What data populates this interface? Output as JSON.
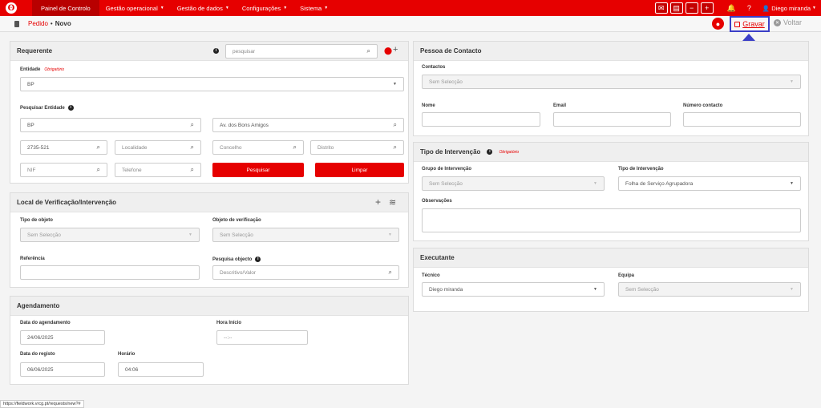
{
  "nav": {
    "items": [
      {
        "label": "Painel de Controlo",
        "caret": ""
      },
      {
        "label": "Gestão operacional",
        "caret": "▼"
      },
      {
        "label": "Gestão de dados",
        "caret": "▼"
      },
      {
        "label": "Configurações",
        "caret": "▼"
      },
      {
        "label": "Sistema",
        "caret": "▼"
      }
    ],
    "user": "Diego miranda"
  },
  "breadcrumb": {
    "link": "Pedido",
    "sep": "•",
    "current": "Novo"
  },
  "actions": {
    "save": "Gravar",
    "back": "Voltar"
  },
  "requerente": {
    "title": "Requerente",
    "search_placeholder": "pesquisar",
    "entidade_label": "Entidade",
    "required": "Obrigatório",
    "entidade_value": "BP",
    "pesquisar_entidade_label": "Pesquisar Entidade",
    "fields": {
      "nome": "BP",
      "morada": "Av. dos Bons Amigos",
      "cp": "2735-521",
      "localidade": "Localidade",
      "concelho": "Concelho",
      "distrito": "Distrito",
      "nif": "NIF",
      "telefone": "Telefone"
    },
    "btn_pesquisar": "Pesquisar",
    "btn_limpar": "Limpar"
  },
  "local": {
    "title": "Local de Verificação/Intervenção",
    "tipo_objeto_label": "Tipo de objeto",
    "tipo_objeto_value": "Sem Selecção",
    "objeto_verif_label": "Objeto de verificação",
    "objeto_verif_value": "Sem Selecção",
    "referencia_label": "Referência",
    "pesquisa_objecto_label": "Pesquisa objecto",
    "pesquisa_objecto_placeholder": "Descritivo/Valor"
  },
  "agendamento": {
    "title": "Agendamento",
    "data_agend_label": "Data do agendamento",
    "data_agend_value": "24/06/2025",
    "hora_inicio_label": "Hora Início",
    "hora_inicio_value": "--:--",
    "data_registo_label": "Data do registo",
    "data_registo_value": "06/06/2025",
    "horario_label": "Horário",
    "horario_value": "04:06"
  },
  "contacto": {
    "title": "Pessoa de Contacto",
    "contactos_label": "Contactos",
    "contactos_value": "Sem Selecção",
    "nome_label": "Nome",
    "email_label": "Email",
    "numero_label": "Número contacto"
  },
  "intervencao": {
    "title": "Tipo de Intervenção",
    "required": "Obrigatório",
    "grupo_label": "Grupo de Intervenção",
    "grupo_value": "Sem Selecção",
    "tipo_label": "Tipo de Intervenção",
    "tipo_value": "Folha de Serviço Agrupadora",
    "obs_label": "Observações"
  },
  "executante": {
    "title": "Executante",
    "tecnico_label": "Técnico",
    "tecnico_value": "Diego miranda",
    "equipa_label": "Equipa",
    "equipa_value": "Sem Selecção"
  },
  "status_url": "https://fieldwork.vrcg.pt/requests/new?#"
}
